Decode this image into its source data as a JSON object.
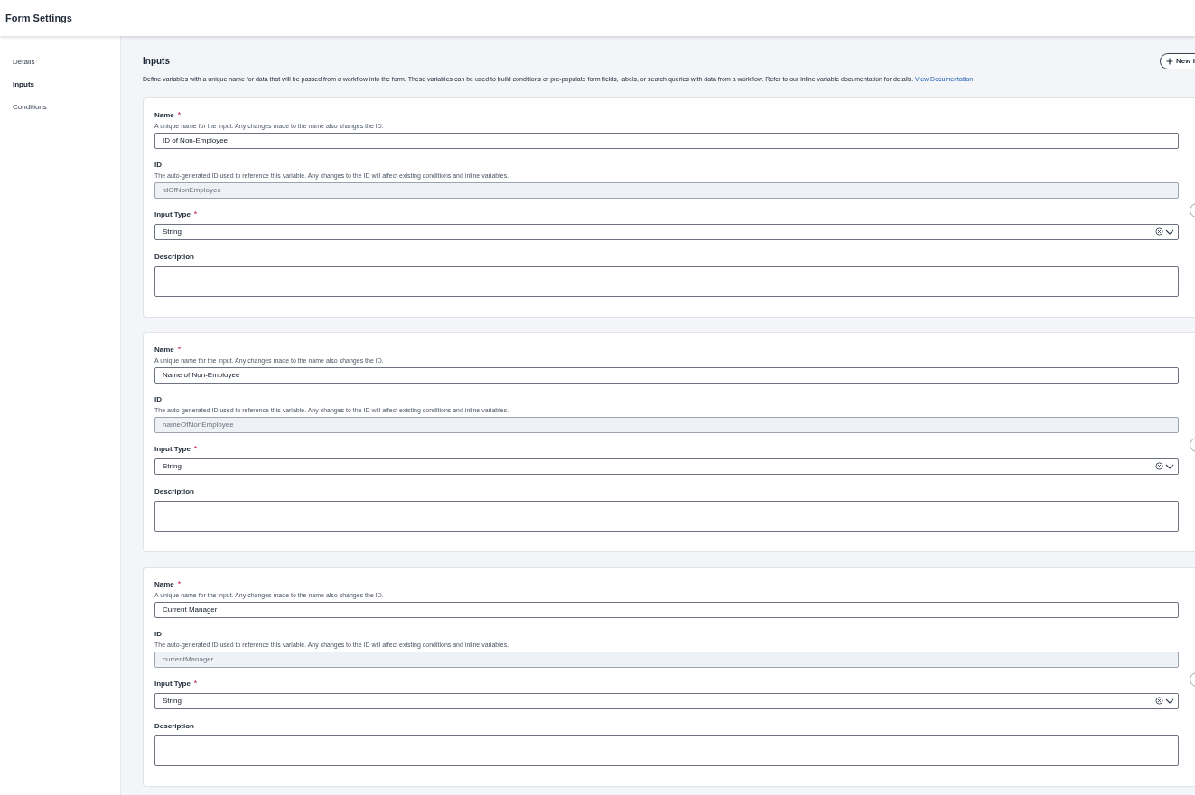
{
  "header": {
    "title": "Form Settings"
  },
  "sidebar": {
    "items": [
      {
        "label": "Details",
        "selected": false
      },
      {
        "label": "Inputs",
        "selected": true
      },
      {
        "label": "Conditions",
        "selected": false
      }
    ]
  },
  "section": {
    "title": "Inputs",
    "description": "Define variables with a unique name for data that will be passed from a workflow into the form. These variables can be used to build conditions or pre-populate form fields, labels, or search queries with data from a workflow. Refer to our inline variable documentation for details.",
    "link": "View Documentation",
    "new_button": "New I"
  },
  "inputs": [
    {
      "name_label": "Name",
      "name_mark": "*",
      "name_hint": "A unique name for the input. Any changes made to the name also changes the ID.",
      "name_value": "ID of Non-Employee",
      "id_label": "ID",
      "id_hint": "The auto-generated ID used to reference this variable. Any changes to the ID will affect existing conditions and inline variables.",
      "id_value": "idOfNonEmployee",
      "type_label": "Input Type",
      "type_mark": "*",
      "type_value": "String",
      "description_label": "Description"
    },
    {
      "name_label": "Name",
      "name_mark": "*",
      "name_hint": "A unique name for the input. Any changes made to the name also changes the ID.",
      "name_value": "Name of Non-Employee",
      "id_label": "ID",
      "id_hint": "The auto-generated ID used to reference this variable. Any changes to the ID will affect existing conditions and inline variables.",
      "id_value": "nameOfNonEmployee",
      "type_label": "Input Type",
      "type_mark": "*",
      "type_value": "String",
      "description_label": "Description"
    },
    {
      "name_label": "Name",
      "name_mark": "*",
      "name_hint": "A unique name for the input. Any changes made to the name also changes the ID.",
      "name_value": "Current Manager",
      "id_label": "ID",
      "id_hint": "The auto-generated ID used to reference this variable. Any changes to the ID will affect existing conditions and inline variables.",
      "id_value": "currentManager",
      "type_label": "Input Type",
      "type_mark": "*",
      "type_value": "String",
      "description_label": "Description"
    }
  ]
}
